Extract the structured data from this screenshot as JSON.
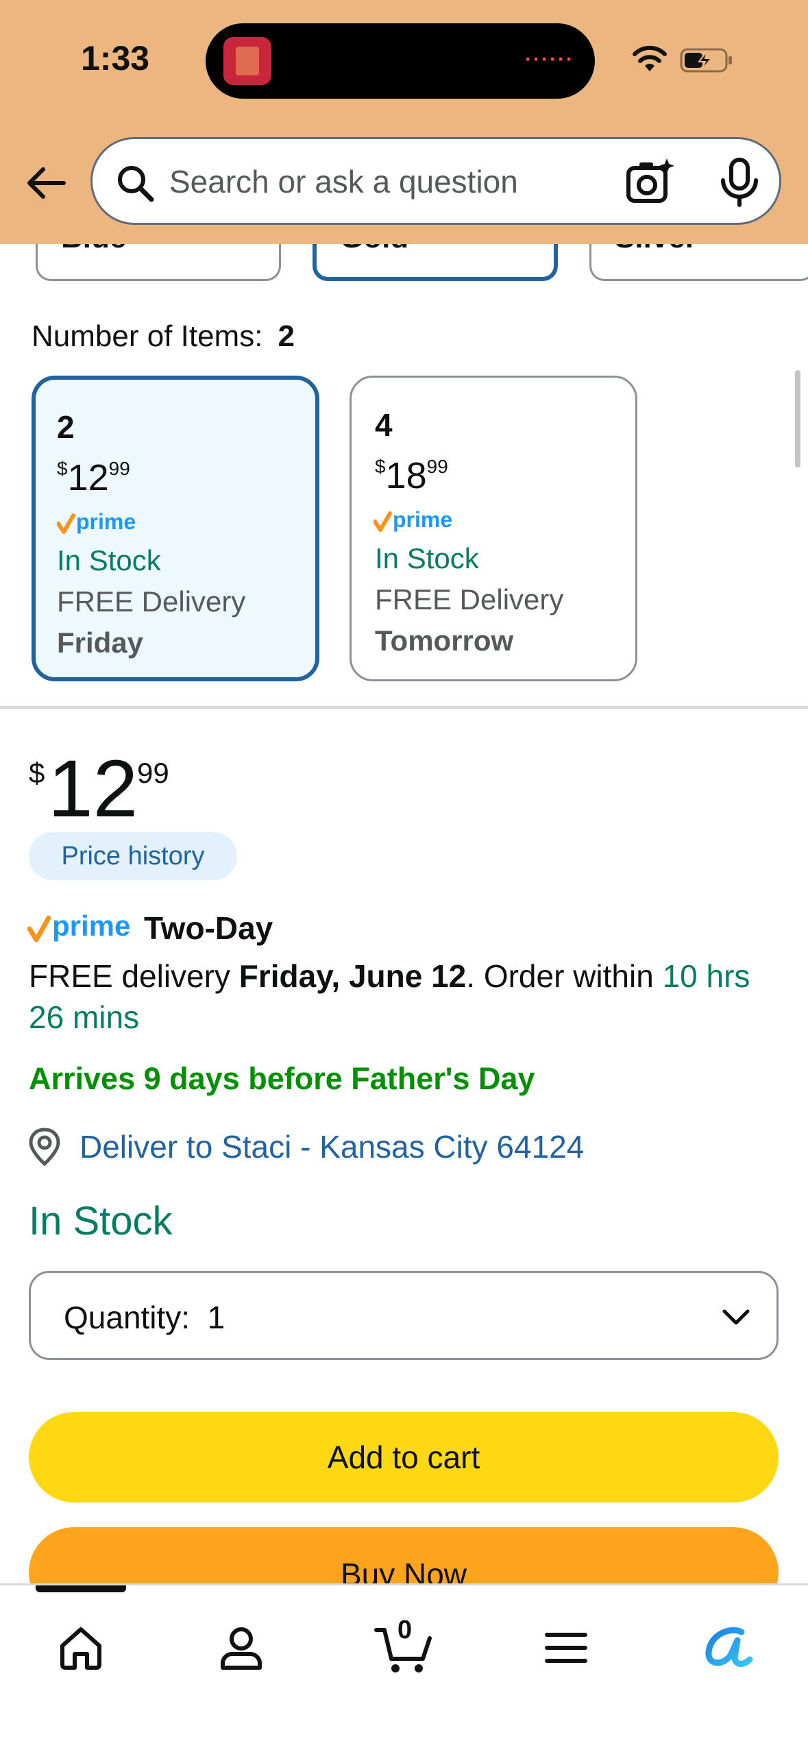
{
  "status_bar": {
    "time": "1:33"
  },
  "search": {
    "placeholder": "Search or ask a question"
  },
  "color_options": [
    {
      "label": "Blue",
      "selected": false
    },
    {
      "label": "Gold",
      "selected": true
    },
    {
      "label": "Silver",
      "selected": false
    }
  ],
  "items": {
    "label": "Number of Items:",
    "selected_value": "2",
    "options": [
      {
        "count": "2",
        "currency": "$",
        "whole": "12",
        "fraction": "99",
        "prime": "prime",
        "stock": "In Stock",
        "delivery": "FREE Delivery",
        "day": "Friday",
        "selected": true
      },
      {
        "count": "4",
        "currency": "$",
        "whole": "18",
        "fraction": "99",
        "prime": "prime",
        "stock": "In Stock",
        "delivery": "FREE Delivery",
        "day": "Tomorrow",
        "selected": false
      }
    ]
  },
  "price": {
    "currency": "$",
    "whole": "12",
    "fraction": "99"
  },
  "price_history_label": "Price history",
  "prime_delivery": {
    "prime_text": "prime",
    "two_day": "Two-Day",
    "free_delivery": "FREE delivery ",
    "date": "Friday, June 12",
    "order_within": ". Order within ",
    "countdown": "10 hrs 26 mins"
  },
  "fathers_day": "Arrives 9 days before Father's Day",
  "deliver_to": "Deliver to Staci - Kansas City 64124",
  "in_stock": "In Stock",
  "quantity": {
    "label": "Quantity:",
    "value": "1"
  },
  "buttons": {
    "add_to_cart": "Add to cart",
    "buy_now": "Buy Now"
  },
  "tab_bar": {
    "cart_count": "0",
    "tabs": [
      "home-icon",
      "account-icon",
      "cart-icon",
      "menu-icon",
      "rufus-icon"
    ]
  },
  "colors": {
    "header": "#ebb67f",
    "link_blue": "#2162a1",
    "stock_green": "#067d62",
    "promo_green": "#009000",
    "add_to_cart": "#ffd814",
    "buy_now": "#ffa41c",
    "prime_blue": "#1a98ff",
    "prime_check": "#f7941d"
  }
}
